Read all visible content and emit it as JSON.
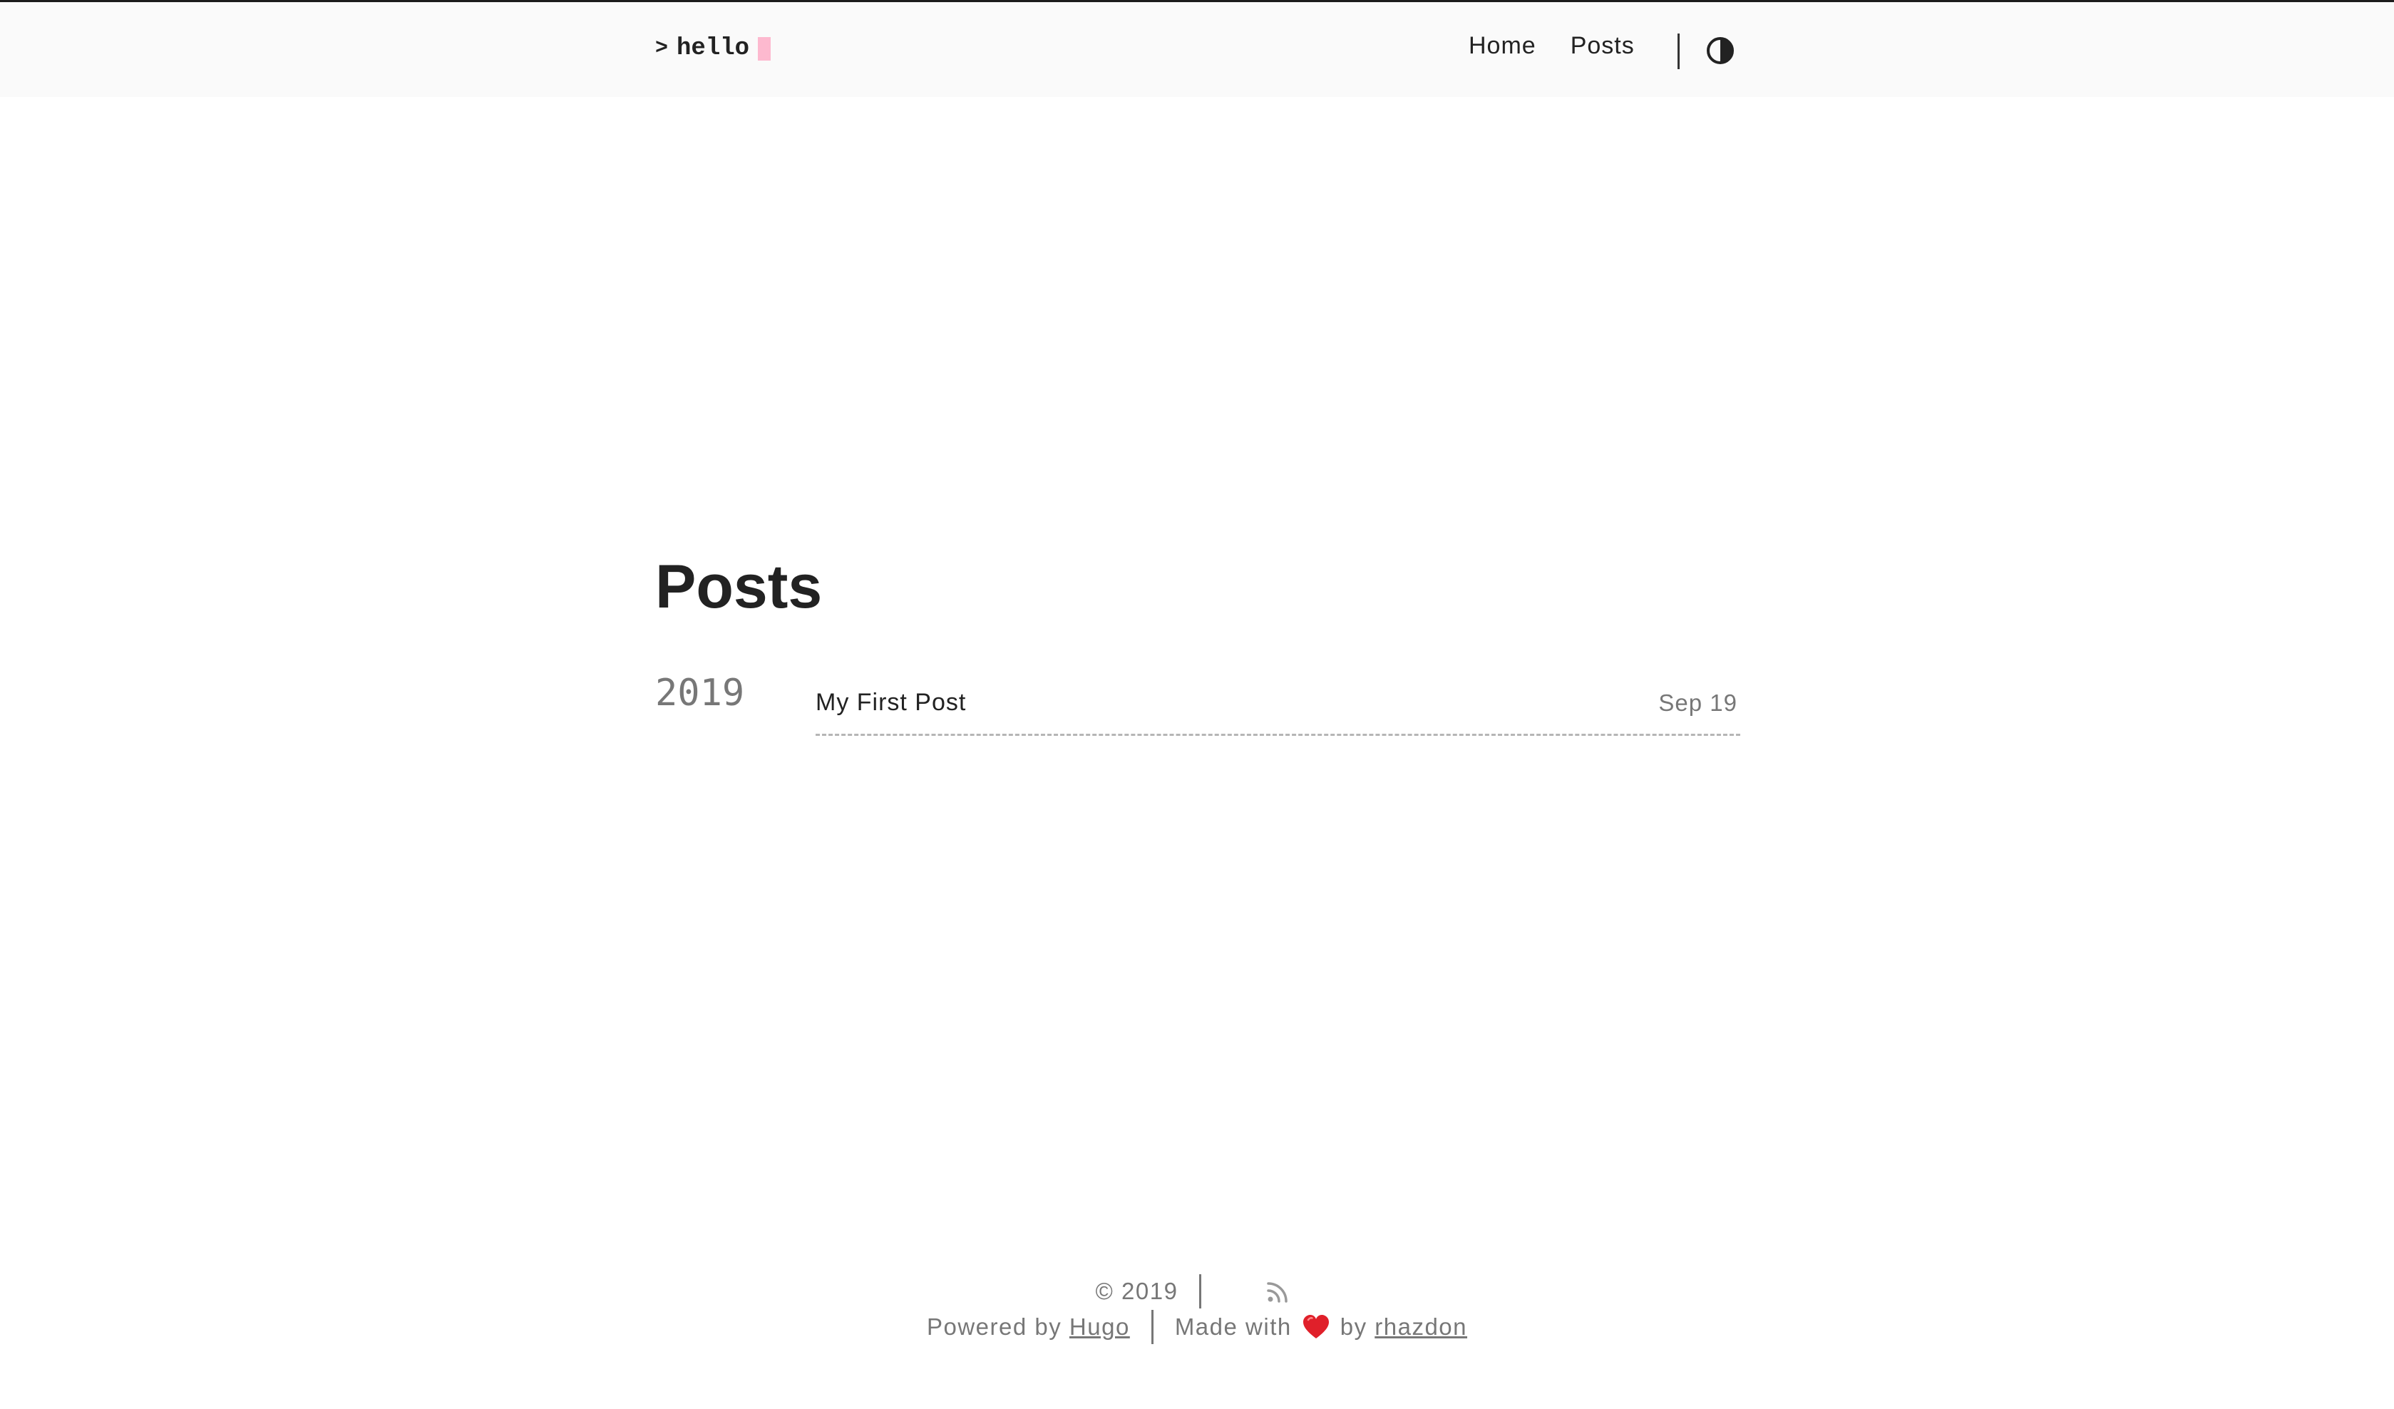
{
  "site": {
    "logo_prompt": ">",
    "logo_text": "hello",
    "cursor_color": "#fdb9cf"
  },
  "nav": {
    "items": [
      {
        "label": "Home"
      },
      {
        "label": "Posts"
      }
    ],
    "theme_toggle_icon": "half-circle-contrast-icon"
  },
  "main": {
    "page_title": "Posts",
    "groups": [
      {
        "year": "2019",
        "posts": [
          {
            "title": "My First Post",
            "date": "Sep 19"
          }
        ]
      }
    ]
  },
  "footer": {
    "copyright": "© 2019",
    "rss_icon": "rss-icon",
    "powered_by_prefix": "Powered by",
    "powered_by_link": "Hugo",
    "made_with_prefix": "Made with",
    "heart_icon": "heart-icon",
    "made_with_by": "by",
    "author_link": "rhazdon",
    "heart_color": "#e0202a"
  }
}
